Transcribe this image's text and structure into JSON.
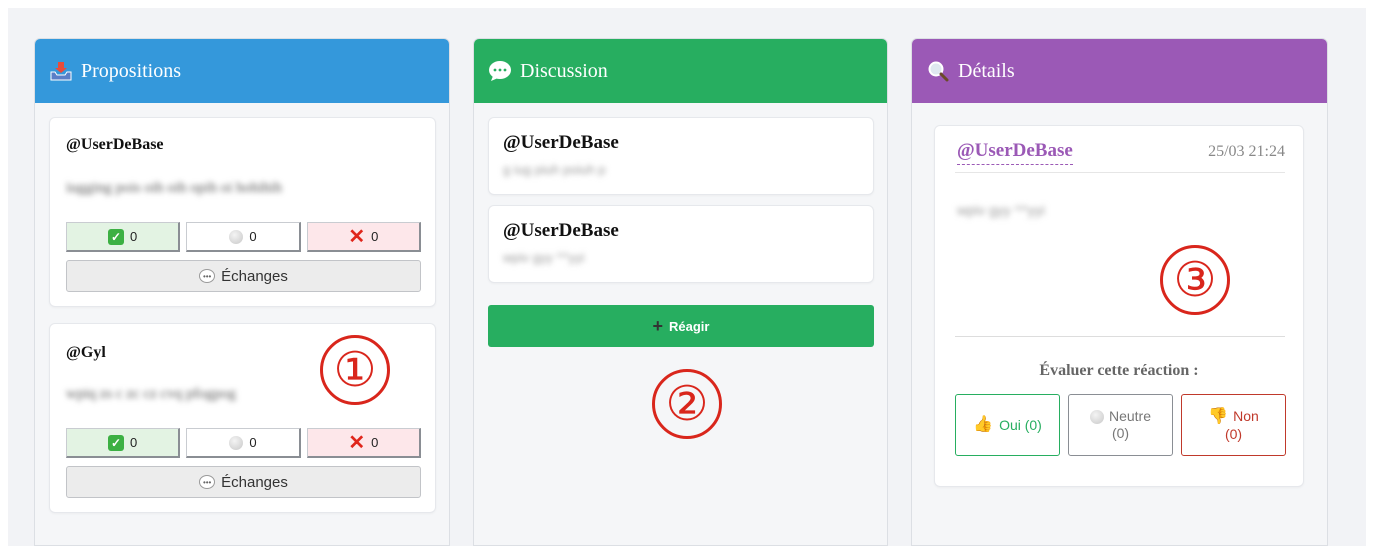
{
  "colors": {
    "propositions": "#3498db",
    "discussion": "#27ae60",
    "details": "#9b59b6",
    "annotation": "#d9261c"
  },
  "propositions": {
    "title": "Propositions",
    "icon": "inbox-tray-icon",
    "items": [
      {
        "user": "@UserDeBase",
        "text": "iugging pois oih oih opih oi hohihih",
        "yes": "0",
        "neutral": "0",
        "no": "0",
        "exchanges": "Échanges"
      },
      {
        "user": "@Gyl",
        "text": "wpiq zs c zc cz cvq pfogpog",
        "yes": "0",
        "neutral": "0",
        "no": "0",
        "exchanges": "Échanges"
      }
    ],
    "annotation": "①"
  },
  "discussion": {
    "title": "Discussion",
    "icon": "speech-bubble-icon",
    "items": [
      {
        "user": "@UserDeBase",
        "text": "g iug piuh poiuh p"
      },
      {
        "user": "@UserDeBase",
        "text": "wpiv gyy ^^yyi"
      }
    ],
    "react_label": "Réagir",
    "annotation": "②"
  },
  "details": {
    "title": "Détails",
    "icon": "magnifier-icon",
    "user": "@UserDeBase",
    "time": "25/03 21:24",
    "text": "wpiv gyy ^^yyi",
    "eval_label": "Évaluer cette réaction :",
    "oui": "Oui (0)",
    "neutre_label": "Neutre",
    "neutre_count": "(0)",
    "non_label": "Non",
    "non_count": "(0)",
    "annotation": "③"
  }
}
